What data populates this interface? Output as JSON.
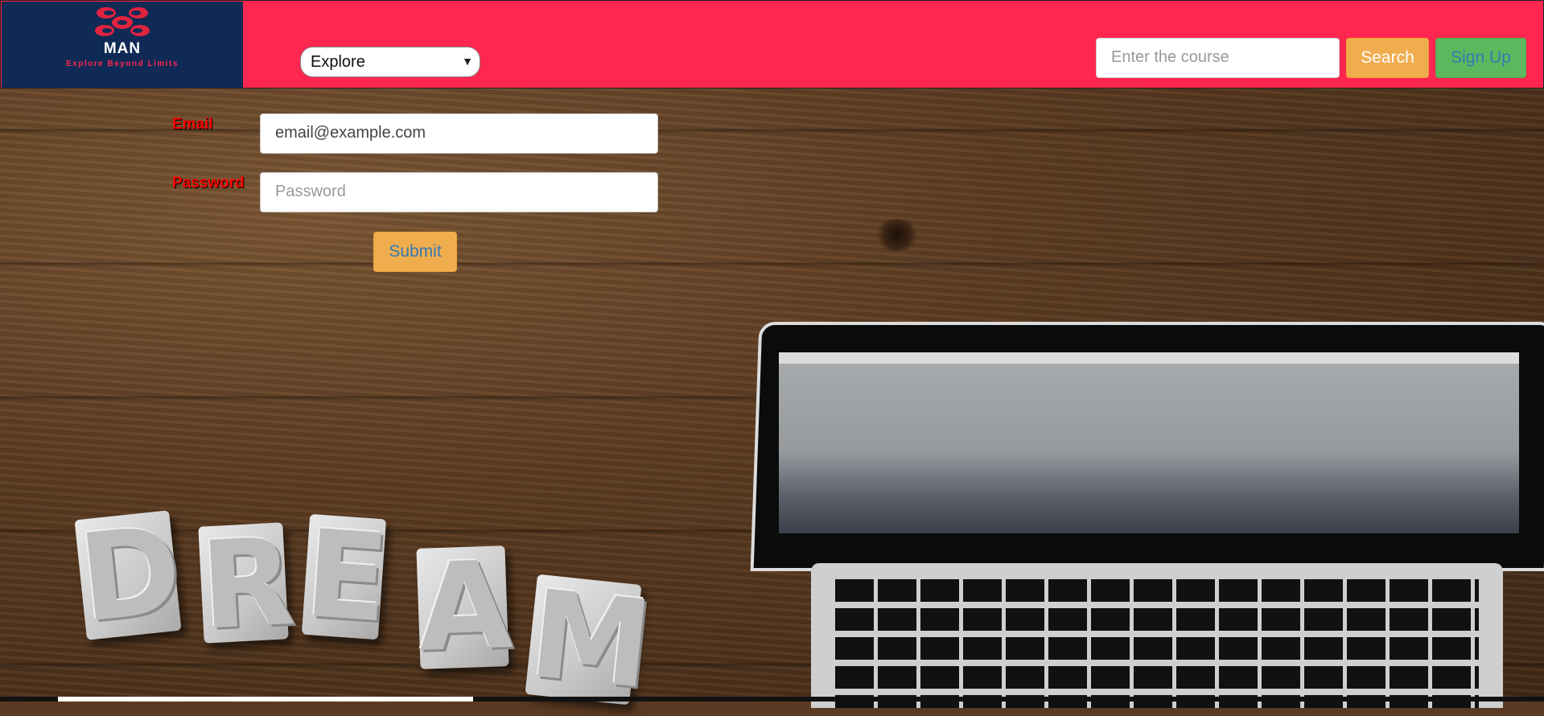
{
  "brand": {
    "name": "MAN",
    "tagline": "Explore Beyond Limits"
  },
  "nav": {
    "explore_value": "Explore",
    "search_placeholder": "Enter the course",
    "search_label": "Search",
    "signup_label": "Sign Up"
  },
  "login_form": {
    "email_label": "Email",
    "email_value": "email@example.com",
    "password_label": "Password",
    "password_placeholder": "Password",
    "submit_label": "Submit"
  },
  "hero_image": {
    "letters": [
      "D",
      "R",
      "E",
      "A",
      "M"
    ]
  },
  "colors": {
    "navbar": "#ff264f",
    "logo_bg": "#0f2a55",
    "search_button": "#f0ad4e",
    "signup_button": "#5cb85c",
    "label_text": "#ff0000"
  }
}
